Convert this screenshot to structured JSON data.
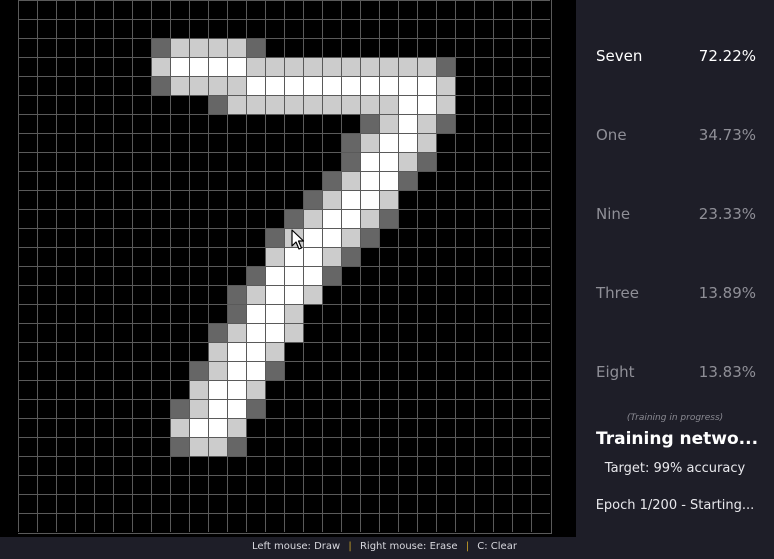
{
  "canvas": {
    "grid_size": 28,
    "digit_pixels": [
      {
        "r": 2,
        "cells": [
          [
            7,
            0.4
          ],
          [
            8,
            0.8
          ],
          [
            9,
            0.8
          ],
          [
            10,
            0.8
          ],
          [
            11,
            0.8
          ],
          [
            12,
            0.4
          ]
        ]
      },
      {
        "r": 3,
        "cells": [
          [
            7,
            0.8
          ],
          [
            8,
            1
          ],
          [
            9,
            1
          ],
          [
            10,
            1
          ],
          [
            11,
            1
          ],
          [
            12,
            0.8
          ],
          [
            13,
            0.8
          ],
          [
            14,
            0.8
          ],
          [
            15,
            0.8
          ],
          [
            16,
            0.8
          ],
          [
            17,
            0.8
          ],
          [
            18,
            0.8
          ],
          [
            19,
            0.8
          ],
          [
            20,
            0.8
          ],
          [
            21,
            0.8
          ],
          [
            22,
            0.4
          ]
        ]
      },
      {
        "r": 4,
        "cells": [
          [
            7,
            0.4
          ],
          [
            8,
            0.8
          ],
          [
            9,
            0.8
          ],
          [
            10,
            0.8
          ],
          [
            11,
            0.8
          ],
          [
            12,
            1
          ],
          [
            13,
            1
          ],
          [
            14,
            1
          ],
          [
            15,
            1
          ],
          [
            16,
            1
          ],
          [
            17,
            1
          ],
          [
            18,
            1
          ],
          [
            19,
            1
          ],
          [
            20,
            1
          ],
          [
            21,
            1
          ],
          [
            22,
            0.8
          ]
        ]
      },
      {
        "r": 5,
        "cells": [
          [
            10,
            0.4
          ],
          [
            11,
            0.8
          ],
          [
            12,
            0.8
          ],
          [
            13,
            0.8
          ],
          [
            14,
            0.8
          ],
          [
            15,
            0.8
          ],
          [
            16,
            0.8
          ],
          [
            17,
            0.8
          ],
          [
            18,
            0.8
          ],
          [
            19,
            0.8
          ],
          [
            20,
            1
          ],
          [
            21,
            1
          ],
          [
            22,
            0.8
          ]
        ]
      },
      {
        "r": 6,
        "cells": [
          [
            18,
            0.4
          ],
          [
            19,
            0.8
          ],
          [
            20,
            1
          ],
          [
            21,
            0.8
          ],
          [
            22,
            0.4
          ]
        ]
      },
      {
        "r": 7,
        "cells": [
          [
            17,
            0.4
          ],
          [
            18,
            0.8
          ],
          [
            19,
            1
          ],
          [
            20,
            1
          ],
          [
            21,
            0.8
          ]
        ]
      },
      {
        "r": 8,
        "cells": [
          [
            17,
            0.4
          ],
          [
            18,
            1
          ],
          [
            19,
            1
          ],
          [
            20,
            0.8
          ],
          [
            21,
            0.4
          ]
        ]
      },
      {
        "r": 9,
        "cells": [
          [
            16,
            0.4
          ],
          [
            17,
            0.8
          ],
          [
            18,
            1
          ],
          [
            19,
            1
          ],
          [
            20,
            0.4
          ]
        ]
      },
      {
        "r": 10,
        "cells": [
          [
            15,
            0.4
          ],
          [
            16,
            0.8
          ],
          [
            17,
            1
          ],
          [
            18,
            1
          ],
          [
            19,
            0.8
          ]
        ]
      },
      {
        "r": 11,
        "cells": [
          [
            14,
            0.4
          ],
          [
            15,
            0.8
          ],
          [
            16,
            1
          ],
          [
            17,
            1
          ],
          [
            18,
            0.8
          ],
          [
            19,
            0.4
          ]
        ]
      },
      {
        "r": 12,
        "cells": [
          [
            13,
            0.4
          ],
          [
            14,
            0.8
          ],
          [
            15,
            1
          ],
          [
            16,
            1
          ],
          [
            17,
            0.8
          ],
          [
            18,
            0.4
          ]
        ]
      },
      {
        "r": 13,
        "cells": [
          [
            13,
            0.8
          ],
          [
            14,
            1
          ],
          [
            15,
            1
          ],
          [
            16,
            0.8
          ],
          [
            17,
            0.4
          ]
        ]
      },
      {
        "r": 14,
        "cells": [
          [
            12,
            0.4
          ],
          [
            13,
            1
          ],
          [
            14,
            1
          ],
          [
            15,
            1
          ],
          [
            16,
            0.4
          ]
        ]
      },
      {
        "r": 15,
        "cells": [
          [
            11,
            0.4
          ],
          [
            12,
            0.8
          ],
          [
            13,
            1
          ],
          [
            14,
            1
          ],
          [
            15,
            0.8
          ]
        ]
      },
      {
        "r": 16,
        "cells": [
          [
            11,
            0.4
          ],
          [
            12,
            1
          ],
          [
            13,
            1
          ],
          [
            14,
            0.8
          ]
        ]
      },
      {
        "r": 17,
        "cells": [
          [
            10,
            0.4
          ],
          [
            11,
            0.8
          ],
          [
            12,
            1
          ],
          [
            13,
            1
          ],
          [
            14,
            0.8
          ]
        ]
      },
      {
        "r": 18,
        "cells": [
          [
            10,
            0.8
          ],
          [
            11,
            1
          ],
          [
            12,
            1
          ],
          [
            13,
            0.8
          ]
        ]
      },
      {
        "r": 19,
        "cells": [
          [
            9,
            0.4
          ],
          [
            10,
            0.8
          ],
          [
            11,
            1
          ],
          [
            12,
            1
          ],
          [
            13,
            0.4
          ]
        ]
      },
      {
        "r": 20,
        "cells": [
          [
            9,
            0.8
          ],
          [
            10,
            1
          ],
          [
            11,
            1
          ],
          [
            12,
            0.8
          ]
        ]
      },
      {
        "r": 21,
        "cells": [
          [
            8,
            0.4
          ],
          [
            9,
            0.8
          ],
          [
            10,
            1
          ],
          [
            11,
            1
          ],
          [
            12,
            0.4
          ]
        ]
      },
      {
        "r": 22,
        "cells": [
          [
            8,
            0.8
          ],
          [
            9,
            1
          ],
          [
            10,
            1
          ],
          [
            11,
            0.8
          ]
        ]
      },
      {
        "r": 23,
        "cells": [
          [
            8,
            0.4
          ],
          [
            9,
            0.8
          ],
          [
            10,
            0.8
          ],
          [
            11,
            0.4
          ]
        ]
      }
    ]
  },
  "predictions": [
    {
      "label": "Seven",
      "value": "72.22%",
      "top": true
    },
    {
      "label": "One",
      "value": "34.73%",
      "top": false
    },
    {
      "label": "Nine",
      "value": "23.33%",
      "top": false
    },
    {
      "label": "Three",
      "value": "13.89%",
      "top": false
    },
    {
      "label": "Eight",
      "value": "13.83%",
      "top": false
    }
  ],
  "status": {
    "note": "(Training in progress)",
    "title": "Training netwo...",
    "target": "Target: 99% accuracy",
    "epoch": "Epoch 1/200 - Starting..."
  },
  "footer": {
    "left_mouse": "Left mouse: Draw",
    "right_mouse": "Right mouse: Erase",
    "clear": "C: Clear",
    "separator": "|"
  },
  "colors": {
    "background": "#1e1e28",
    "canvas": "#000000",
    "grid_line": "#5a5a5a",
    "separator": "#c9a227",
    "top_prediction": "#ffffff",
    "other_prediction": "#8f8f97"
  },
  "icons": {
    "cursor": "mouse-pointer-icon"
  }
}
